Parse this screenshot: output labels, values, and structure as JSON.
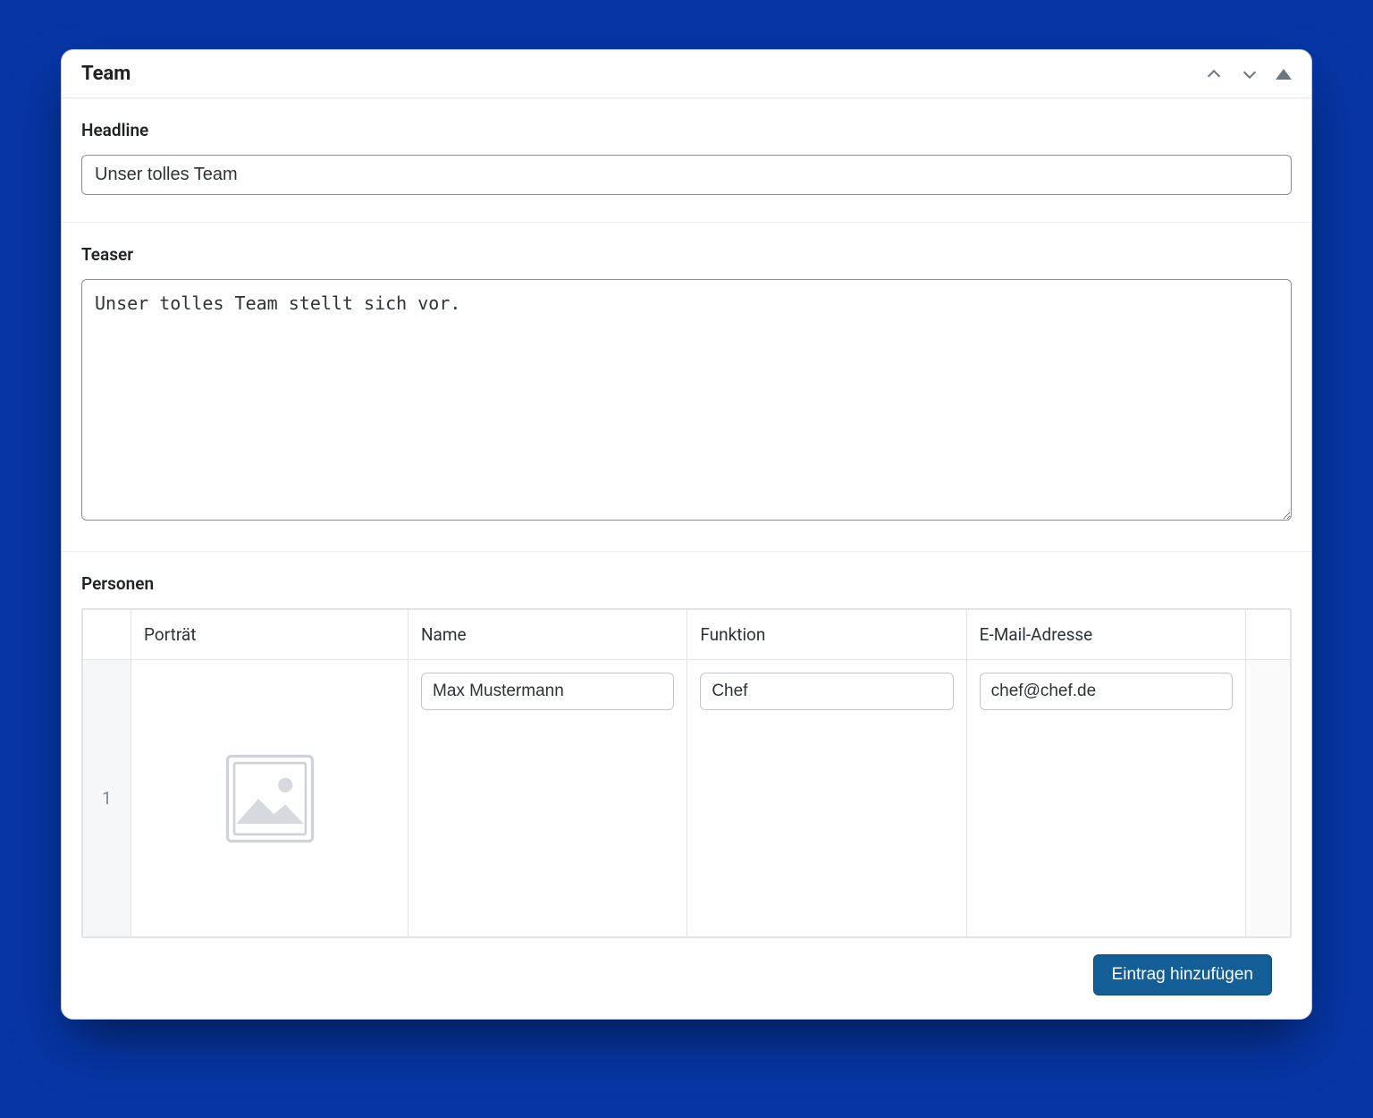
{
  "panel": {
    "title": "Team"
  },
  "fields": {
    "headline_label": "Headline",
    "headline_value": "Unser tolles Team",
    "teaser_label": "Teaser",
    "teaser_value": "Unser tolles Team stellt sich vor.",
    "personen_label": "Personen"
  },
  "table": {
    "headers": {
      "portrait": "Porträt",
      "name": "Name",
      "funktion": "Funktion",
      "email": "E-Mail-Adresse"
    },
    "rows": [
      {
        "index": "1",
        "name": "Max Mustermann",
        "funktion": "Chef",
        "email": "chef@chef.de"
      }
    ]
  },
  "actions": {
    "add_entry": "Eintrag hinzufügen"
  }
}
